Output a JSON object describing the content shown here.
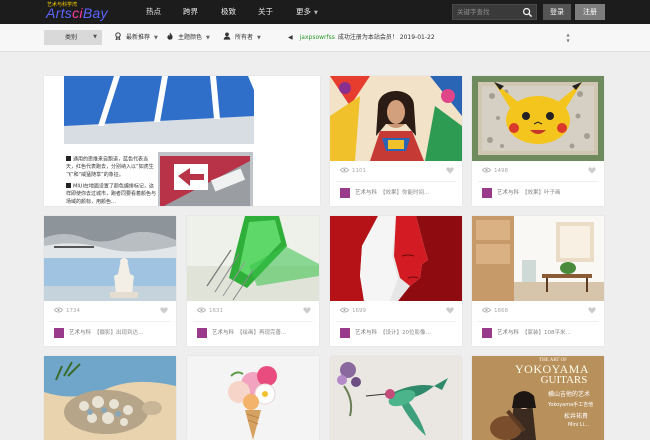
{
  "colors": {
    "nav_bg": "#1c1c1c",
    "logo_blue": "#5b66ff",
    "logo_pink": "#ff3aa7",
    "notice_user": "#2a9a2a",
    "avatar": "#9a3a8a"
  },
  "header": {
    "logo_subtitle": "艺术与科学湾",
    "logo_part1": "Arts",
    "logo_part2": "ci",
    "logo_part3": "Bay",
    "nav": [
      "热点",
      "跨界",
      "极致",
      "关于",
      "更多"
    ],
    "search_placeholder": "关键字查找",
    "login": "登录",
    "register": "注册"
  },
  "filters": {
    "category": "类别",
    "latest": "最新推荐",
    "theme_color": "主题颜色",
    "owner": "所有者",
    "notice_user": "jaxpsowrfss",
    "notice_text": "成功注册为本站会员！ 2019-01-22"
  },
  "featured": {
    "paragraph1": "通用的思维来自跑道，蓝色代表当天，红色代表跑去，分别纳入以“如虎生飞”和“威猛随享”的象征。",
    "paragraph2": "MIUI在地面设置了颜色编排标记，这样即使你去过城市，跑者同要看着颜色与场域的颜标，用颜色…"
  },
  "cards": [
    {
      "views": "1101",
      "author": "艺术与科",
      "title": "【效果】你能时间…"
    },
    {
      "views": "1498",
      "author": "艺术与科",
      "title": "【效果】叶子画"
    },
    {
      "views": "1734",
      "author": "艺术与科",
      "title": "【摄影】出现到达…"
    },
    {
      "views": "1631",
      "author": "艺术与科",
      "title": "【绘画】再现完善…"
    },
    {
      "views": "1699",
      "author": "艺术与科",
      "title": "【设计】20位影像…"
    },
    {
      "views": "1668",
      "author": "艺术与科",
      "title": "【家装】108平米…"
    }
  ],
  "bottom_cards": {
    "yokoyama_header": "THE ART OF",
    "yokoyama_title": "YOKOYAMA",
    "yokoyama_title2": "GUITARS",
    "yokoyama_cn": "横山吉他的艺术",
    "yokoyama_sub1": "Yokoyama手工吉他",
    "yokoyama_sub2": "松井祐貴",
    "yokoyama_sub3": "Mini Li…"
  }
}
